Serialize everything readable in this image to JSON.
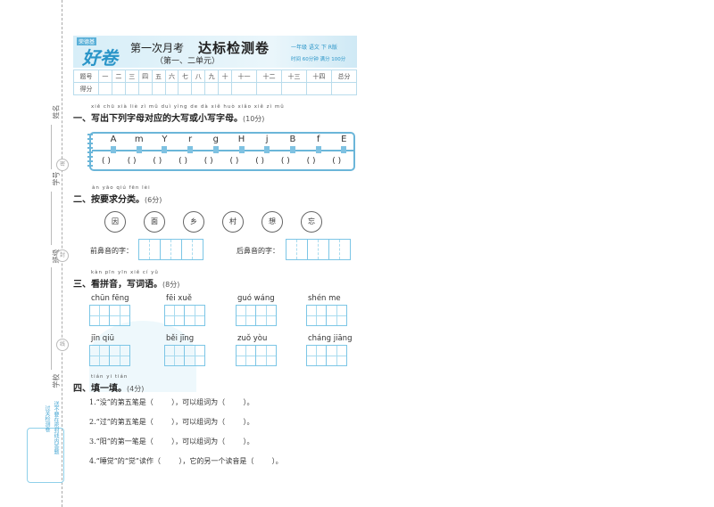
{
  "side": {
    "labels": [
      "姓名",
      "学号",
      "班级",
      "学校"
    ],
    "seals": [
      "密",
      "封",
      "线"
    ],
    "promo": [
      "过关检测卷",
      "送不要在密封线内答题"
    ]
  },
  "header": {
    "badge": "荣德基",
    "logo": "好卷",
    "title": "第一次月考",
    "title_bold": "达标检测卷",
    "subtitle": "（第一、二单元）",
    "meta_line1": "一年级 语文 下 R版",
    "meta_line2": "时间 60分钟 满分 100分"
  },
  "score_table": {
    "row1_label": "题号",
    "columns": [
      "一",
      "二",
      "三",
      "四",
      "五",
      "六",
      "七",
      "八",
      "九",
      "十",
      "十一",
      "十二",
      "十三",
      "十四",
      "总分"
    ],
    "row2_label": "得分"
  },
  "section1": {
    "pinyin": "xiě chū xià liè zì mǔ duì yìng de dà xiě huò xiǎo xiě zì mǔ",
    "title": "一、写出下列字母对应的大写或小写字母。",
    "points": "(10分)",
    "letters": [
      "A",
      "m",
      "Y",
      "r",
      "g",
      "H",
      "j",
      "B",
      "f",
      "E"
    ],
    "blank": "(    )"
  },
  "section2": {
    "pinyin": "àn yāo qiú fēn lèi",
    "title": "二、按要求分类。",
    "points": "(6分)",
    "chars": [
      "因",
      "面",
      "乡",
      "村",
      "想",
      "忘"
    ],
    "front_label": "前鼻音的字：",
    "back_label": "后鼻音的字："
  },
  "section3": {
    "pinyin": "kàn pīn yīn  xiě cí yǔ",
    "title": "三、看拼音，写词语。",
    "points": "(8分)",
    "words": [
      "chūn fēng",
      "fēi xuě",
      "guó wáng",
      "shén me",
      "jīn qiū",
      "běi jīng",
      "zuǒ yòu",
      "cháng jiāng"
    ]
  },
  "section4": {
    "pinyin": "tián yi tián",
    "title": "四、填一填。",
    "points": "(4分)",
    "questions": [
      "1.“没”的第五笔是（        ），可以组词为（        ）。",
      "2.“过”的第五笔是（        ），可以组词为（        ）。",
      "3.“阳”的第一笔是（        ），可以组词为（        ）。",
      "4.“睡觉”的“觉”读作（        ），它的另一个读音是（        ）。"
    ]
  }
}
